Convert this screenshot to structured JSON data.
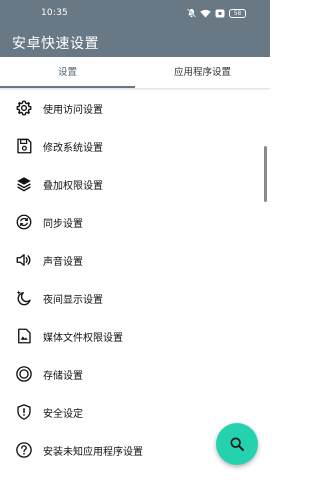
{
  "status_bar": {
    "time": "10:35",
    "icons": [
      "mute-icon",
      "wifi-icon",
      "notification-badge-icon",
      "battery-icon"
    ],
    "battery_level": "58"
  },
  "app_bar": {
    "title": "安卓快速设置",
    "background": "#687985"
  },
  "tabs": [
    {
      "label": "设置",
      "selected": true
    },
    {
      "label": "应用程序设置",
      "selected": false
    }
  ],
  "settings_list": [
    {
      "label": "使用访问设置",
      "icon": "gear-icon"
    },
    {
      "label": "修改系统设置",
      "icon": "save-icon"
    },
    {
      "label": "叠加权限设置",
      "icon": "layers-icon"
    },
    {
      "label": "同步设置",
      "icon": "sync-icon"
    },
    {
      "label": "声音设置",
      "icon": "speaker-icon"
    },
    {
      "label": "夜间显示设置",
      "icon": "night-mode-icon"
    },
    {
      "label": "媒体文件权限设置",
      "icon": "image-file-icon"
    },
    {
      "label": "存储设置",
      "icon": "storage-icon"
    },
    {
      "label": "安全设定",
      "icon": "shield-icon"
    },
    {
      "label": "安装未知应用程序设置",
      "icon": "help-icon"
    }
  ],
  "fab": {
    "icon": "search-icon",
    "color": "#25d2b0"
  }
}
